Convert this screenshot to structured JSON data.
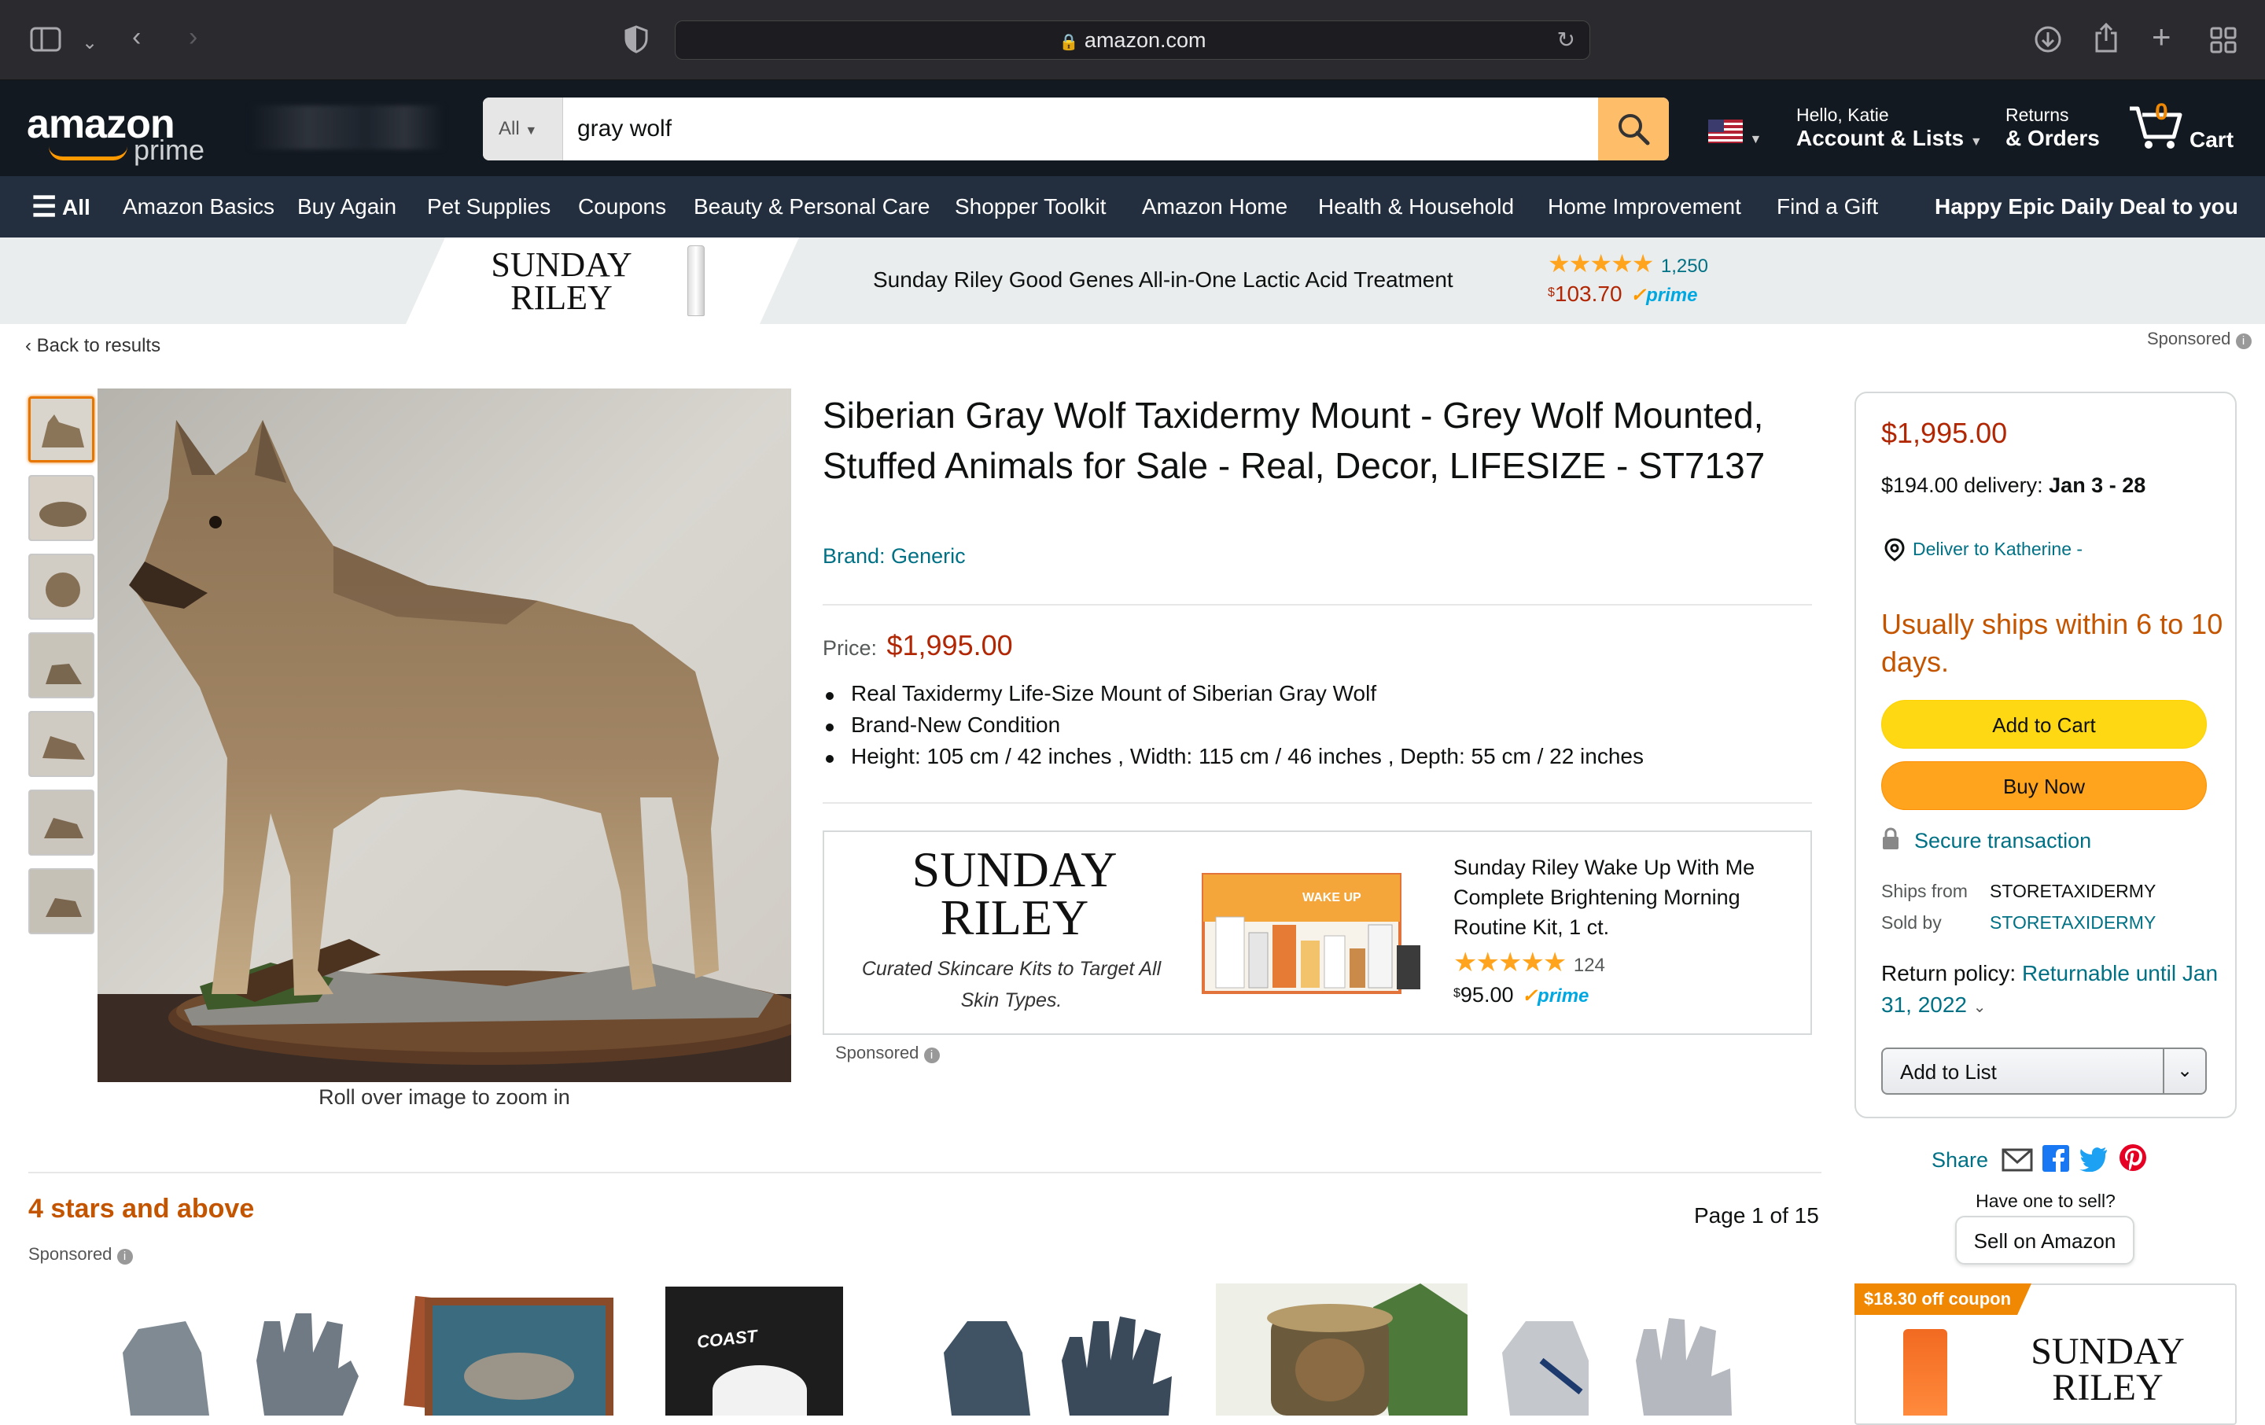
{
  "browser": {
    "url": "amazon.com"
  },
  "header": {
    "logo_text": "amazon",
    "logo_sub": "prime",
    "search_category": "All",
    "search_value": "gray wolf",
    "greeting": "Hello, Katie",
    "account_label": "Account & Lists",
    "returns_top": "Returns",
    "returns_bottom": "& Orders",
    "cart_count": "0",
    "cart_label": "Cart"
  },
  "nav": {
    "all": "All",
    "items": [
      "Amazon Basics",
      "Buy Again",
      "Pet Supplies",
      "Coupons",
      "Beauty & Personal Care",
      "Shopper Toolkit",
      "Amazon Home",
      "Health & Household",
      "Home Improvement",
      "Find a Gift"
    ],
    "promo": "Happy Epic Daily Deal to you"
  },
  "banner": {
    "brand_line1": "SUNDAY",
    "brand_line2": "RILEY",
    "product": "Sunday Riley Good Genes All-in-One Lactic Acid Treatment",
    "rating_count": "1,250",
    "price_symbol": "$",
    "price": "103.70",
    "prime": "prime",
    "sponsored": "Sponsored"
  },
  "back_link": "Back to results",
  "gallery": {
    "zoom_hint": "Roll over image to zoom in"
  },
  "product": {
    "title": "Siberian Gray Wolf Taxidermy Mount - Grey Wolf Mounted, Stuffed Animals for Sale - Real, Decor, LIFESIZE - ST7137",
    "brand": "Brand: Generic",
    "price_label": "Price:",
    "price": "$1,995.00",
    "bullets": [
      "Real Taxidermy Life-Size Mount of Siberian Gray Wolf",
      "Brand-New Condition",
      "Height: 105 cm / 42 inches , Width: 115 cm / 46 inches , Depth: 55 cm / 22 inches"
    ]
  },
  "ad": {
    "brand_line1": "SUNDAY",
    "brand_line2": "RILEY",
    "tagline": "Curated Skincare Kits to Target All Skin Types.",
    "box_label": "WAKE UP",
    "product": "Sunday Riley Wake Up With Me Complete Brightening Morning Routine Kit, 1 ct.",
    "rating_count": "124",
    "price_symbol": "$",
    "price": "95.00",
    "prime": "prime",
    "sponsored": "Sponsored"
  },
  "buybox": {
    "price": "$1,995.00",
    "delivery_prefix": "$194.00 delivery:",
    "delivery_dates": "Jan 3 - 28",
    "deliver_to": "Deliver to Katherine -",
    "availability": "Usually ships within 6 to 10 days.",
    "add_to_cart": "Add to Cart",
    "buy_now": "Buy Now",
    "secure": "Secure transaction",
    "ships_from_label": "Ships from",
    "ships_from": "STORETAXIDERMY",
    "sold_by_label": "Sold by",
    "sold_by": "STORETAXIDERMY",
    "return_label": "Return policy:",
    "return_link": "Returnable until Jan 31, 2022",
    "add_to_list": "Add to List",
    "share": "Share",
    "have_one": "Have one to sell?",
    "sell": "Sell on Amazon",
    "coupon": "$18.30 off coupon",
    "coupon_brand_line1": "SUNDAY",
    "coupon_brand_line2": "RILEY"
  },
  "related": {
    "heading": "4 stars and above",
    "page": "Page 1 of 15",
    "sponsored": "Sponsored",
    "mask_brand": "COAST"
  },
  "colors": {
    "header": "#131921",
    "nav": "#232f3e",
    "price": "#b12704",
    "link": "#007185",
    "cart_button": "#ffd814",
    "buy_button": "#ffa41c",
    "heading_orange": "#c45500"
  }
}
